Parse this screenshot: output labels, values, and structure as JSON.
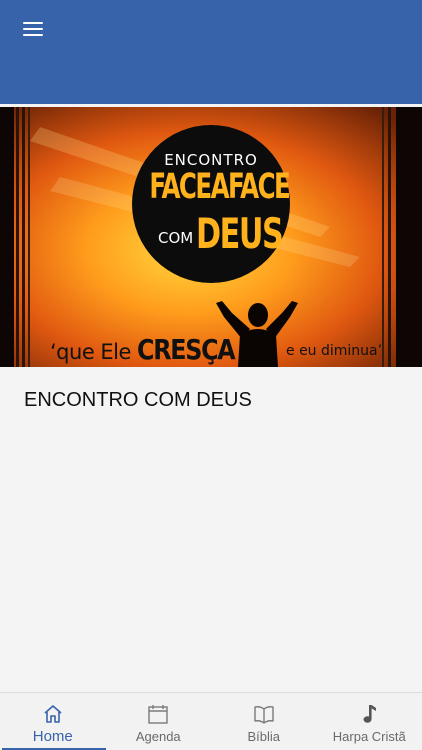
{
  "header": {
    "menu_icon": "hamburger-menu-icon",
    "color": "#3763aa"
  },
  "banner": {
    "logo_line1": "ENCONTRO",
    "logo_line2": "FACEAFACE",
    "logo_com": "COM",
    "logo_deus": "DEUS",
    "tagline_open": "‘que Ele",
    "tagline_cresca": "CRESÇA",
    "tagline_close": "e eu diminua’"
  },
  "content": {
    "title": "ENCONTRO COM DEUS"
  },
  "bottom_nav": {
    "items": [
      {
        "label": "Home",
        "icon": "home-icon",
        "active": true
      },
      {
        "label": "Agenda",
        "icon": "calendar-icon",
        "active": false
      },
      {
        "label": "Bíblia",
        "icon": "book-icon",
        "active": false
      },
      {
        "label": "Harpa Cristã",
        "icon": "music-note-icon",
        "active": false
      }
    ],
    "active_color": "#3763aa",
    "inactive_color": "#6a6a6a"
  }
}
